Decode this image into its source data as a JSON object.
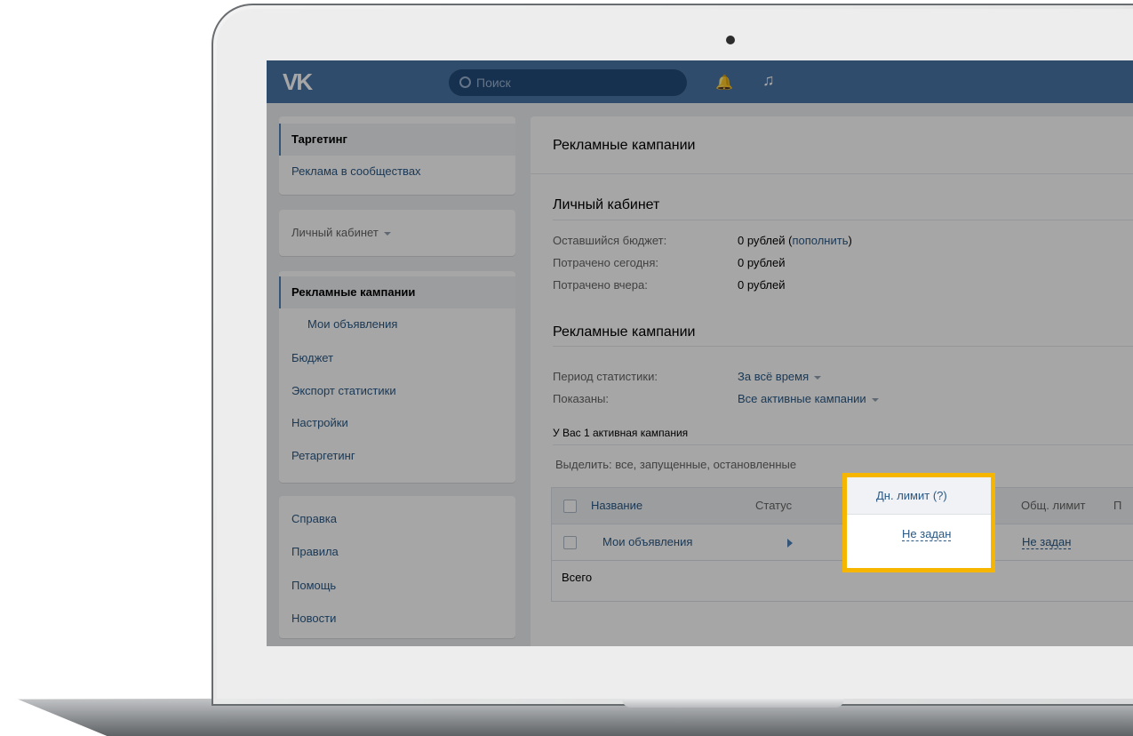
{
  "topbar": {
    "logo": "VK",
    "search_placeholder": "Поиск",
    "bell_icon": "bell-icon",
    "music_icon": "music-icon",
    "accent_color": "#4a76a8"
  },
  "sidebar": {
    "group1": [
      {
        "label": "Таргетинг",
        "active": true
      },
      {
        "label": "Реклама в сообществах",
        "active": false
      }
    ],
    "account_selector": "Личный кабинет",
    "group2": [
      {
        "label": "Рекламные кампании",
        "active": true
      },
      {
        "label": "Мои объявления",
        "sub": true
      },
      {
        "label": "Бюджет"
      },
      {
        "label": "Экспорт статистики"
      },
      {
        "label": "Настройки"
      },
      {
        "label": "Ретаргетинг"
      }
    ],
    "group3": [
      {
        "label": "Справка"
      },
      {
        "label": "Правила"
      },
      {
        "label": "Помощь"
      },
      {
        "label": "Новости"
      }
    ]
  },
  "main": {
    "page_title": "Рекламные кампании",
    "account_section_title": "Личный кабинет",
    "budget_rows": [
      {
        "label": "Оставшийся бюджет:",
        "value": "0 рублей",
        "link": "пополнить"
      },
      {
        "label": "Потрачено сегодня:",
        "value": "0 рублей"
      },
      {
        "label": "Потрачено вчера:",
        "value": "0 рублей"
      }
    ],
    "campaigns_section_title": "Рекламные кампании",
    "period_label": "Период статистики:",
    "period_value": "За всё время",
    "shown_label": "Показаны:",
    "shown_value": "Все активные кампании",
    "active_count_text": "У Вас 1 активная кампания",
    "select_text": "Выделить: все, запущенные, остановленные",
    "table": {
      "headers": {
        "name": "Название",
        "status": "Статус",
        "daily_limit": "Дн. лимит (?)",
        "total_limit": "Общ. лимит",
        "next": "П"
      },
      "rows": [
        {
          "name": "Мои объявления",
          "daily_limit": "Не задан",
          "total_limit": "Не задан"
        }
      ],
      "total_label": "Всего"
    }
  },
  "highlight_color": "#f6b600"
}
